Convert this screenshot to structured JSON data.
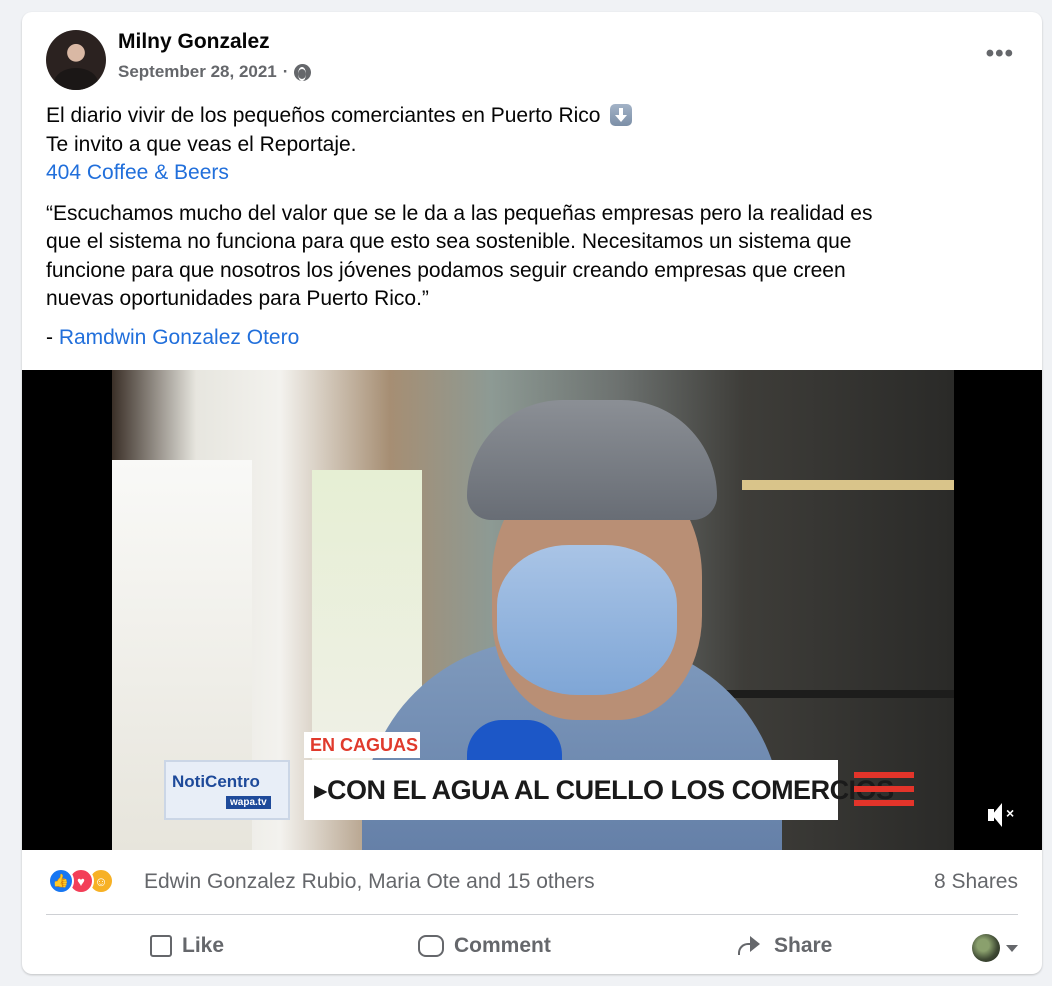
{
  "post": {
    "author": "Milny Gonzalez",
    "date": "September 28, 2021",
    "separator": "·",
    "audience_icon": "globe-icon",
    "more_label": "•••"
  },
  "text": {
    "line1": "El diario vivir de los pequeños comerciantes en Puerto Rico",
    "line2": "Te invito a que veas el Reportaje.",
    "link_business": "404 Coffee & Beers",
    "quote_lines": [
      "“Escuchamos mucho del valor que se le da a las pequeñas empresas pero la realidad es",
      "que el sistema no funciona para que esto sea sostenible. Necesitamos un sistema que",
      "funcione para que nosotros los jóvenes podamos seguir creando empresas que creen",
      "nuevas oportunidades para Puerto Rico.”"
    ],
    "attribution_prefix": "- ",
    "attribution_name": "Ramdwin Gonzalez Otero"
  },
  "video": {
    "location_tag": "EN CAGUAS",
    "logo_text": "NotiCentro",
    "logo_sub": "wapa.tv",
    "headline": "▸CON EL AGUA AL CUELLO LOS COMERCIOS",
    "mute_icon": "speaker-muted-icon"
  },
  "engagement": {
    "reactors": "Edwin Gonzalez Rubio, Maria Ote and 15 others",
    "shares": "8 Shares",
    "reaction_types": [
      "like",
      "love",
      "care"
    ]
  },
  "actions": {
    "like": "Like",
    "comment": "Comment",
    "share": "Share"
  },
  "colors": {
    "link": "#216fdb",
    "muted_text": "#65676b",
    "like_blue": "#1877f2",
    "love_red": "#f33e58",
    "care_yellow": "#f7b125"
  }
}
